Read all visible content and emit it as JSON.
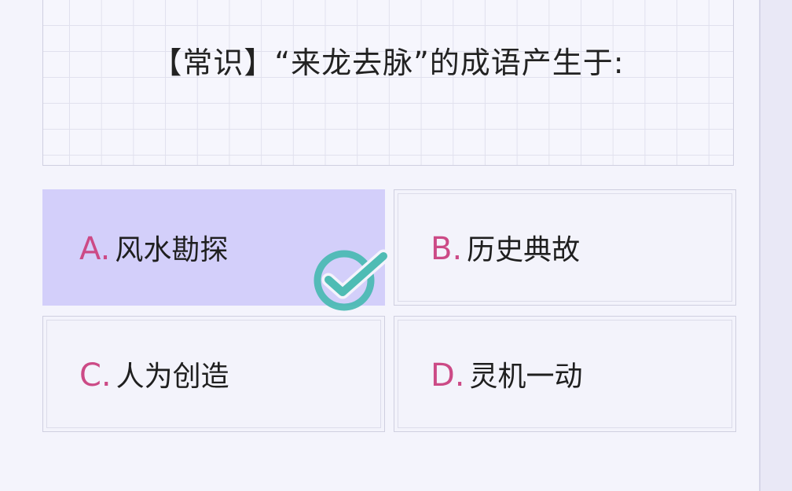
{
  "question": {
    "text": "【常识】“来龙去脉”的成语产生于:"
  },
  "options": [
    {
      "letter": "A.",
      "text": "风水勘探",
      "selected": true
    },
    {
      "letter": "B.",
      "text": "历史典故",
      "selected": false
    },
    {
      "letter": "C.",
      "text": "人为创造",
      "selected": false
    },
    {
      "letter": "D.",
      "text": "灵机一动",
      "selected": false
    }
  ],
  "colors": {
    "selected_bg": "#d3cffa",
    "letter": "#cc4a86",
    "check": "#45b8b0"
  },
  "icons": {
    "selected_marker": "checkmark-circle-icon"
  }
}
